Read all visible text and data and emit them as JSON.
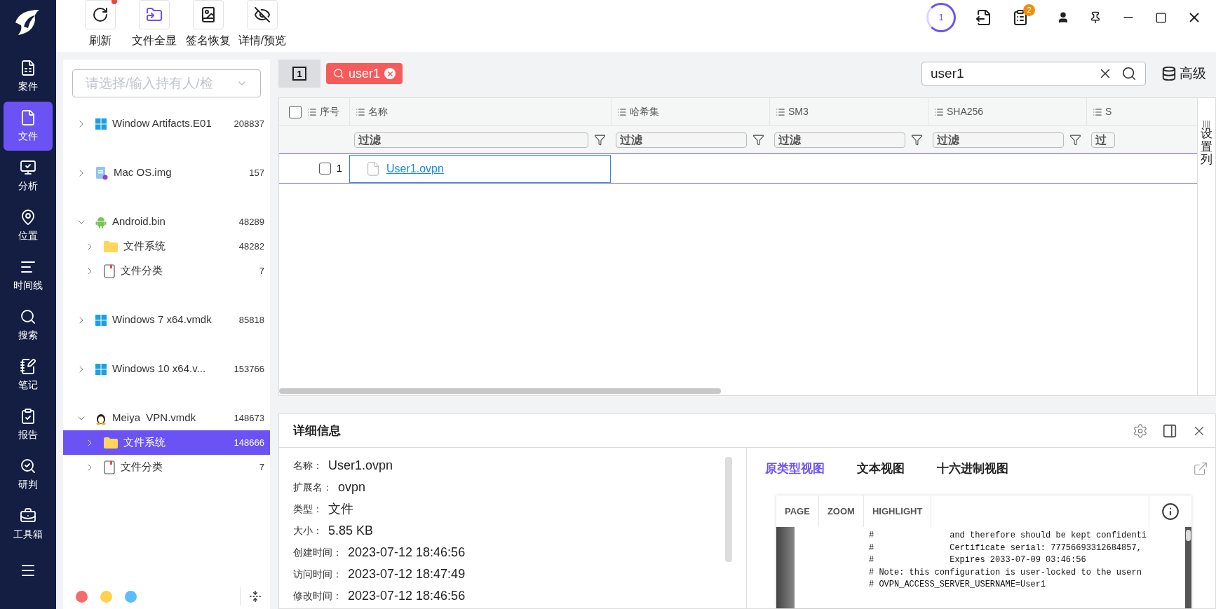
{
  "toolbar": {
    "buttons": [
      {
        "kind": "refresh",
        "label": "刷新",
        "badge": true
      },
      {
        "kind": "folder",
        "label": "文件全显",
        "badge": false
      },
      {
        "kind": "restore",
        "label": "签名恢复",
        "badge": false
      },
      {
        "kind": "eye",
        "label": "详情/预览",
        "badge": false
      }
    ]
  },
  "status": {
    "task_count": "1",
    "notice_count": "2"
  },
  "nav": [
    {
      "kind": "case",
      "label": "案件",
      "selected": false
    },
    {
      "kind": "file",
      "label": "文件",
      "selected": true
    },
    {
      "kind": "analysis",
      "label": "分析",
      "selected": false
    },
    {
      "kind": "location",
      "label": "位置",
      "selected": false
    },
    {
      "kind": "timeline",
      "label": "时间线",
      "selected": false
    },
    {
      "kind": "search",
      "label": "搜索",
      "selected": false
    },
    {
      "kind": "note",
      "label": "笔记",
      "selected": false
    },
    {
      "kind": "report",
      "label": "报告",
      "selected": false
    },
    {
      "kind": "judge",
      "label": "研判",
      "selected": false
    },
    {
      "kind": "toolbox",
      "label": "工具箱",
      "selected": false
    }
  ],
  "tree": {
    "placeholder": "请选择/输入持有人/检",
    "items": [
      {
        "kind": "windows",
        "label": "Window Artifacts.E01",
        "count": "208837",
        "expanded": false,
        "selected": false
      },
      {
        "kind": "image",
        "label": "Mac OS.img",
        "count": "157",
        "expanded": false,
        "selected": false
      },
      {
        "kind": "android",
        "label": "Android.bin",
        "count": "48289",
        "expanded": true,
        "selected": false,
        "children": [
          {
            "kind": "folder",
            "label": "文件系统",
            "count": "48282",
            "expanded": false,
            "selected": false
          },
          {
            "kind": "doc",
            "label": "文件分类",
            "count": "7",
            "expanded": false,
            "selected": false
          }
        ]
      },
      {
        "kind": "windows",
        "label": "Windows 7 x64.vmdk",
        "count": "85818",
        "expanded": false,
        "selected": false
      },
      {
        "kind": "windows",
        "label": "Windows 10 x64.v...",
        "count": "153766",
        "expanded": false,
        "selected": false
      },
      {
        "kind": "linux",
        "label": "Meiya  VPN.vmdk",
        "count": "148673",
        "expanded": true,
        "selected": false,
        "children": [
          {
            "kind": "folder",
            "label": "文件系统",
            "count": "148666",
            "expanded": false,
            "selected": true
          },
          {
            "kind": "doc",
            "label": "文件分类",
            "count": "7",
            "expanded": false,
            "selected": false
          }
        ]
      }
    ]
  },
  "dots": [
    {
      "color": "#f56c6c"
    },
    {
      "color": "#ffd24d"
    },
    {
      "color": "#5bbcff"
    }
  ],
  "search": {
    "view_button": "1",
    "tag": "user1",
    "value": "user1",
    "advanced": "高级"
  },
  "table": {
    "select_all_checked": false,
    "columns": [
      "序号",
      "名称",
      "哈希集",
      "SM3",
      "SHA256",
      "S"
    ],
    "filters": [
      "过滤",
      "过滤",
      "过滤",
      "过滤",
      "过"
    ],
    "rows": [
      {
        "index": "1",
        "checked": false,
        "name": "User1.ovpn",
        "selected": true
      }
    ],
    "column_settings": "设置列"
  },
  "details": {
    "title": "详细信息",
    "fields": [
      {
        "label": "名称：",
        "value": "User1.ovpn"
      },
      {
        "label": "扩展名：",
        "value": "ovpn"
      },
      {
        "label": "类型：",
        "value": "文件"
      },
      {
        "label": "大小：",
        "value": "5.85 KB"
      },
      {
        "label": "创建时间：",
        "value": "2023-07-12 18:46:56"
      },
      {
        "label": "访问时间：",
        "value": "2023-07-12 18:47:49"
      },
      {
        "label": "修改时间：",
        "value": "2023-07-12 18:46:56"
      }
    ],
    "tabs": [
      {
        "label": "原类型视图",
        "selected": true
      },
      {
        "label": "文本视图",
        "selected": false
      },
      {
        "label": "十六进制视图",
        "selected": false
      }
    ],
    "viewer": {
      "buttons": [
        "PAGE",
        "ZOOM",
        "HIGHLIGHT"
      ],
      "lines": [
        "#               and therefore should be kept confidenti",
        "#               Certificate serial: 77756693312684857,",
        "#               Expires 2033-07-09 03:46:56",
        "# Note: this configuration is user-locked to the usern",
        "# OVPN_ACCESS_SERVER_USERNAME=User1"
      ]
    }
  }
}
